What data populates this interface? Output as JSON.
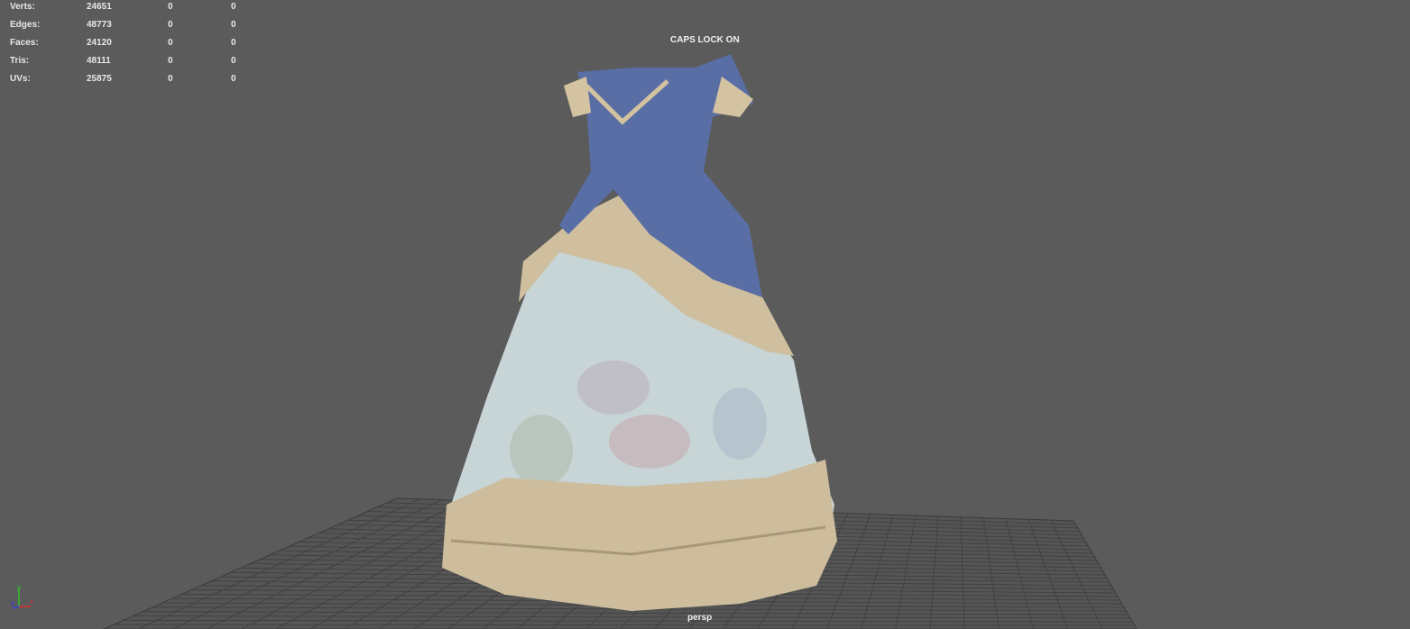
{
  "hud": {
    "rows": [
      {
        "label": "Verts:",
        "value": "24651",
        "sel": "0",
        "sel2": "0"
      },
      {
        "label": "Edges:",
        "value": "48773",
        "sel": "0",
        "sel2": "0"
      },
      {
        "label": "Faces:",
        "value": "24120",
        "sel": "0",
        "sel2": "0"
      },
      {
        "label": "Tris:",
        "value": "48111",
        "sel": "0",
        "sel2": "0"
      },
      {
        "label": "UVs:",
        "value": "25875",
        "sel": "0",
        "sel2": "0"
      }
    ]
  },
  "status": {
    "caps_lock": "CAPS LOCK ON"
  },
  "camera": {
    "name": "persp"
  },
  "axis": {
    "x": "x",
    "y": "y",
    "z": "z",
    "x_color": "#e03030",
    "y_color": "#30c030",
    "z_color": "#3040e0"
  },
  "colors": {
    "background": "#5b5b5b",
    "grid": "#3e3e3e",
    "bodice": "#5a6fa8",
    "skirt": "#c9d6d8",
    "lace": "#d4c3a0"
  }
}
